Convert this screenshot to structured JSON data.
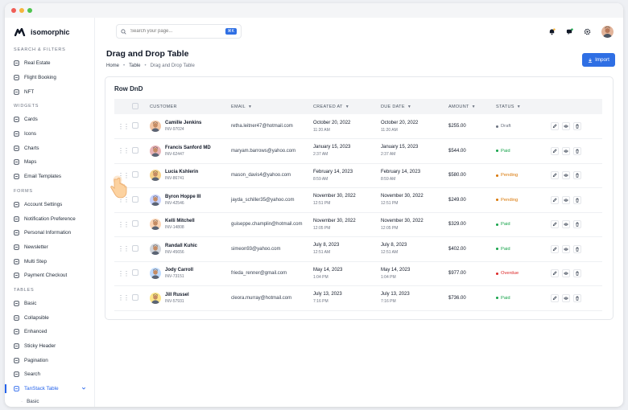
{
  "window": {
    "dots": [
      "#f05d56",
      "#f5b53d",
      "#4fc44f"
    ]
  },
  "logo": {
    "text": "isomorphic"
  },
  "sidebar": {
    "sections": [
      {
        "title": "SEARCH & FILTERS",
        "items": [
          {
            "label": "Real Estate",
            "icon": "building-icon"
          },
          {
            "label": "Flight Booking",
            "icon": "plane-icon"
          },
          {
            "label": "NFT",
            "icon": "nft-icon"
          }
        ]
      },
      {
        "title": "WIDGETS",
        "items": [
          {
            "label": "Cards",
            "icon": "cards-icon"
          },
          {
            "label": "Icons",
            "icon": "icons-icon"
          },
          {
            "label": "Charts",
            "icon": "chart-icon"
          },
          {
            "label": "Maps",
            "icon": "map-pin-icon"
          },
          {
            "label": "Email Templates",
            "icon": "mail-icon"
          }
        ]
      },
      {
        "title": "FORMS",
        "items": [
          {
            "label": "Account Settings",
            "icon": "user-gear-icon"
          },
          {
            "label": "Notification Preference",
            "icon": "bell-settings-icon"
          },
          {
            "label": "Personal Information",
            "icon": "user-icon"
          },
          {
            "label": "Newsletter",
            "icon": "newsletter-icon"
          },
          {
            "label": "Multi Step",
            "icon": "steps-icon"
          },
          {
            "label": "Payment Checkout",
            "icon": "card-icon"
          }
        ]
      },
      {
        "title": "TABLES",
        "items": [
          {
            "label": "Basic",
            "icon": "grid-icon"
          },
          {
            "label": "Collapsible",
            "icon": "collapse-icon"
          },
          {
            "label": "Enhanced",
            "icon": "enhanced-icon"
          },
          {
            "label": "Sticky Header",
            "icon": "sticky-icon"
          },
          {
            "label": "Pagination",
            "icon": "pagination-icon"
          },
          {
            "label": "Search",
            "icon": "search-icon"
          },
          {
            "label": "TanStack Table",
            "icon": "tanstack-icon",
            "active": true
          }
        ]
      }
    ],
    "sub_item": "Basic"
  },
  "search": {
    "placeholder": "Search your page...",
    "shortcut": "⌘K"
  },
  "page": {
    "title": "Drag and Drop Table",
    "breadcrumbs": [
      "Home",
      "Table",
      "Drag and Drop Table"
    ],
    "import_label": "Import"
  },
  "card": {
    "title": "Row DnD"
  },
  "table": {
    "headers": {
      "customer": "CUSTOMER",
      "email": "EMAIL",
      "created": "CREATED AT",
      "due": "DUE DATE",
      "amount": "AMOUNT",
      "status": "STATUS"
    },
    "rows": [
      {
        "name": "Camille Jenkins",
        "inv": "INV-97024",
        "email": "retha.leitner47@hotmail.com",
        "created_date": "October 20, 2022",
        "created_time": "11:20 AM",
        "due_date": "October 20, 2022",
        "due_time": "11:20 AM",
        "amount": "$255.00",
        "status": "Draft"
      },
      {
        "name": "Francis Sanford MD",
        "inv": "INV-62447",
        "email": "maryam.barrows@yahoo.com",
        "created_date": "January 15, 2023",
        "created_time": "2:37 AM",
        "due_date": "January 15, 2023",
        "due_time": "2:37 AM",
        "amount": "$544.00",
        "status": "Paid"
      },
      {
        "name": "Lucia Kshlerin",
        "inv": "INV-86741",
        "email": "mason_davis4@yahoo.com",
        "created_date": "February 14, 2023",
        "created_time": "8:59 AM",
        "due_date": "February 14, 2023",
        "due_time": "8:59 AM",
        "amount": "$580.00",
        "status": "Pending"
      },
      {
        "name": "Byron Hoppe III",
        "inv": "INV-42546",
        "email": "jayda_schiller35@yahoo.com",
        "created_date": "November 30, 2022",
        "created_time": "12:51 PM",
        "due_date": "November 30, 2022",
        "due_time": "12:51 PM",
        "amount": "$249.00",
        "status": "Pending"
      },
      {
        "name": "Kelli Mitchell",
        "inv": "INV-14808",
        "email": "guiseppe.champlin@hotmail.com",
        "created_date": "November 30, 2022",
        "created_time": "12:05 PM",
        "due_date": "November 30, 2022",
        "due_time": "12:05 PM",
        "amount": "$329.00",
        "status": "Paid"
      },
      {
        "name": "Randall Kuhic",
        "inv": "INV-45656",
        "email": "simeon93@yahoo.com",
        "created_date": "July 8, 2023",
        "created_time": "12:51 AM",
        "due_date": "July 8, 2023",
        "due_time": "12:51 AM",
        "amount": "$402.00",
        "status": "Paid"
      },
      {
        "name": "Jody Carroll",
        "inv": "INV-73151",
        "email": "frieda_renner@gmail.com",
        "created_date": "May 14, 2023",
        "created_time": "1:04 PM",
        "due_date": "May 14, 2023",
        "due_time": "1:04 PM",
        "amount": "$977.00",
        "status": "Overdue"
      },
      {
        "name": "Jill Russel",
        "inv": "INV-57931",
        "email": "cleora.murray@hotmail.com",
        "created_date": "July 13, 2023",
        "created_time": "7:16 PM",
        "due_date": "July 13, 2023",
        "due_time": "7:16 PM",
        "amount": "$736.00",
        "status": "Paid"
      }
    ]
  },
  "status_colors": {
    "Draft": "#6b7280",
    "Paid": "#16a34a",
    "Pending": "#d97706",
    "Overdue": "#dc2626"
  },
  "avatar_colors": [
    "#f3c6a5",
    "#e8b4b8",
    "#f6d28b",
    "#c7d2fe",
    "#fcd5b5",
    "#d1d5db",
    "#bfdbfe",
    "#fde68a"
  ],
  "accent": "#2f6fe4"
}
